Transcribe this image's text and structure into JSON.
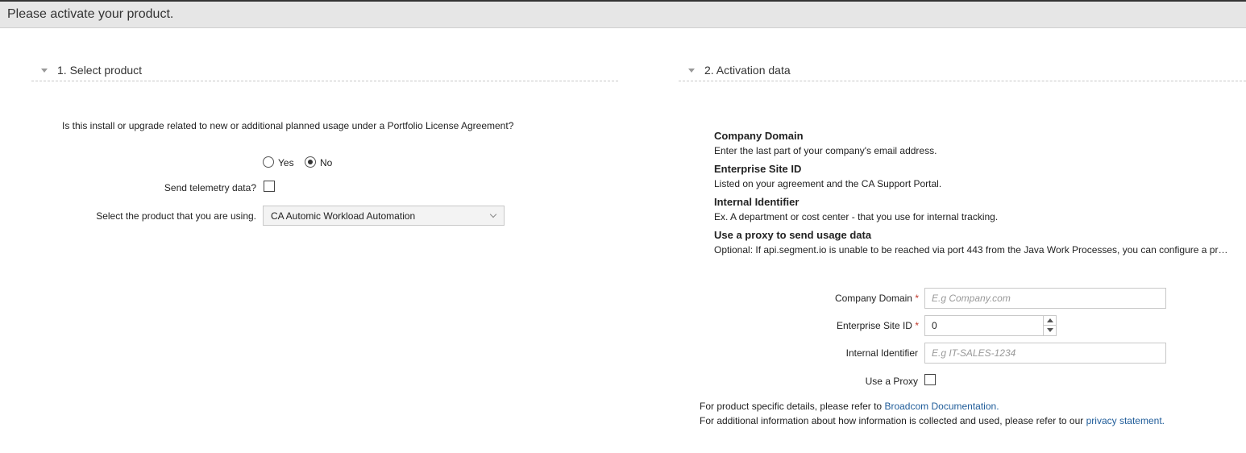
{
  "header": {
    "title": "Please activate your product."
  },
  "sections": {
    "select_product": {
      "title": "1. Select product"
    },
    "activation_data": {
      "title": "2. Activation data"
    }
  },
  "select_product": {
    "question": "Is this install or upgrade related to new or additional planned usage under a Portfolio License Agreement?",
    "yes_label": "Yes",
    "no_label": "No",
    "selected": "No",
    "telemetry_label": "Send telemetry data?",
    "telemetry_checked": false,
    "product_label": "Select the product that you are using.",
    "product_value": "CA Automic Workload Automation"
  },
  "activation_info": {
    "company_domain_title": "Company Domain",
    "company_domain_desc": "Enter the last part of your company's email address.",
    "site_id_title": "Enterprise Site ID",
    "site_id_desc": "Listed on your agreement and the CA Support Portal.",
    "internal_id_title": "Internal Identifier",
    "internal_id_desc": "Ex. A department or cost center - that you use for internal tracking.",
    "proxy_title": "Use a proxy to send usage data",
    "proxy_desc": "Optional: If api.segment.io is unable to be reached via port 443 from the Java Work Processes, you can configure a pr…"
  },
  "form": {
    "company_domain_label": "Company Domain",
    "company_domain_placeholder": "E.g Company.com",
    "site_id_label": "Enterprise Site ID",
    "site_id_value": "0",
    "internal_id_label": "Internal Identifier",
    "internal_id_placeholder": "E.g IT-SALES-1234",
    "proxy_label": "Use a Proxy",
    "required_mark": "*"
  },
  "footer": {
    "details_prefix": "For product specific details, please refer to ",
    "details_link": "Broadcom Documentation",
    "details_suffix": ".",
    "privacy_prefix": "For additional information about how information is collected and used, please refer to our ",
    "privacy_link": "privacy statement",
    "privacy_suffix": "."
  },
  "colors": {
    "link": "#1f5c99",
    "required": "#c0392b",
    "header_bg": "#e6e6e6"
  }
}
